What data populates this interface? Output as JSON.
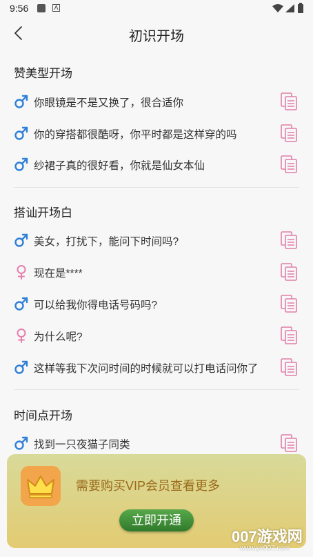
{
  "status_bar": {
    "time": "9:56"
  },
  "header": {
    "title": "初识开场"
  },
  "sections": [
    {
      "title": "赞美型开场",
      "items": [
        {
          "gender": "male",
          "text": "你眼镜是不是又换了，很合适你"
        },
        {
          "gender": "male",
          "text": "你的穿搭都很酷呀，你平时都是这样穿的吗"
        },
        {
          "gender": "male",
          "text": "纱裙子真的很好看，你就是仙女本仙"
        }
      ]
    },
    {
      "title": "搭讪开场白",
      "items": [
        {
          "gender": "male",
          "text": "美女，打扰下，能问下时间吗?"
        },
        {
          "gender": "female",
          "text": "现在是****"
        },
        {
          "gender": "male",
          "text": "可以给我你得电话号码吗?"
        },
        {
          "gender": "female",
          "text": "为什么呢?"
        },
        {
          "gender": "male",
          "text": "这样等我下次问时间的时候就可以打电话问你了"
        }
      ]
    },
    {
      "title": "时间点开场",
      "items": [
        {
          "gender": "male",
          "text": "找到一只夜猫子同类"
        }
      ]
    }
  ],
  "vip_banner": {
    "message": "需要购买VIP会员查看更多",
    "button_label": "立即开通"
  },
  "watermark": {
    "text": "007游戏网",
    "url": "www.yx007.com"
  },
  "colors": {
    "male": "#2f80d8",
    "female": "#e67fae",
    "copy_icon": "#e27fa8",
    "vip_text": "#9a6a1a",
    "button": "#3f8f36"
  }
}
